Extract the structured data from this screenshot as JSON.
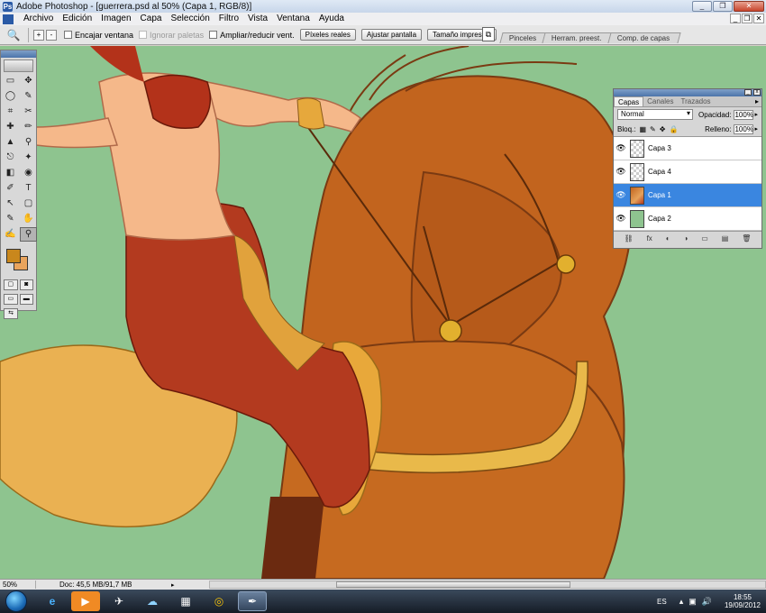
{
  "window": {
    "title": "Adobe Photoshop - [guerrera.psd al 50% (Capa 1, RGB/8)]",
    "controls": [
      "_",
      "❐",
      "✕"
    ],
    "doc_controls": [
      "_",
      "❐",
      "✕"
    ]
  },
  "menu": [
    "Archivo",
    "Edición",
    "Imagen",
    "Capa",
    "Selección",
    "Filtro",
    "Vista",
    "Ventana",
    "Ayuda"
  ],
  "options_bar": {
    "tool_icon": "zoom-icon",
    "zoom_in": "+",
    "zoom_out": "-",
    "encajar": "Encajar ventana",
    "ignorar": "Ignorar paletas",
    "ampliar": "Ampliar/reducir vent.",
    "pixeles_reales": "Píxeles reales",
    "ajustar_pantalla": "Ajustar pantalla",
    "tamano_impresion": "Tamaño impresión",
    "palette_tabs": [
      "Pinceles",
      "Herram. preest.",
      "Comp. de capas"
    ]
  },
  "toolbox": {
    "tools": [
      [
        "▭",
        "✥"
      ],
      [
        "◯",
        "✎"
      ],
      [
        "⌗",
        "✂"
      ],
      [
        "✚",
        "✏"
      ],
      [
        "▲",
        "⚲"
      ],
      [
        "⎋",
        "✦"
      ],
      [
        "◧",
        "◉"
      ],
      [
        "✐",
        "T"
      ],
      [
        "↖",
        "▢"
      ],
      [
        "✎",
        "✋"
      ],
      [
        "✍",
        "⚲"
      ]
    ],
    "fg_color": "#c9871c",
    "bg_color": "#e9a45d"
  },
  "layers_panel": {
    "tabs": [
      "Capas",
      "Canales",
      "Trazados"
    ],
    "blend_mode": "Normal",
    "opacity_label": "Opacidad:",
    "opacity": "100%",
    "lock_label": "Bloq.:",
    "fill_label": "Relleno:",
    "fill": "100%",
    "layers": [
      {
        "name": "Capa 3",
        "thumb": "transparent",
        "selected": false
      },
      {
        "name": "Capa 4",
        "thumb": "transparent",
        "selected": false
      },
      {
        "name": "Capa 1",
        "thumb": "art",
        "selected": true
      },
      {
        "name": "Capa 2",
        "thumb": "green",
        "selected": false
      }
    ],
    "footer_icons": [
      "⛓",
      "fx",
      "◐",
      "◑",
      "▭",
      "▤",
      "🗑"
    ]
  },
  "status": {
    "zoom": "50%",
    "doc": "Doc: 45,5 MB/91,7 MB"
  },
  "taskbar": {
    "apps": [
      "e",
      "▶",
      "✈",
      "☁",
      "▦",
      "◎",
      "✒"
    ],
    "lang": "ES",
    "time": "18:55",
    "date": "19/09/2012"
  },
  "colors": {
    "canvas_bg": "#8ec48f",
    "horse": "#c2641e",
    "saddle": "#e6a83c",
    "pants": "#b33a1f",
    "skin": "#f5b88a",
    "selection_blue": "#3a86e0"
  }
}
